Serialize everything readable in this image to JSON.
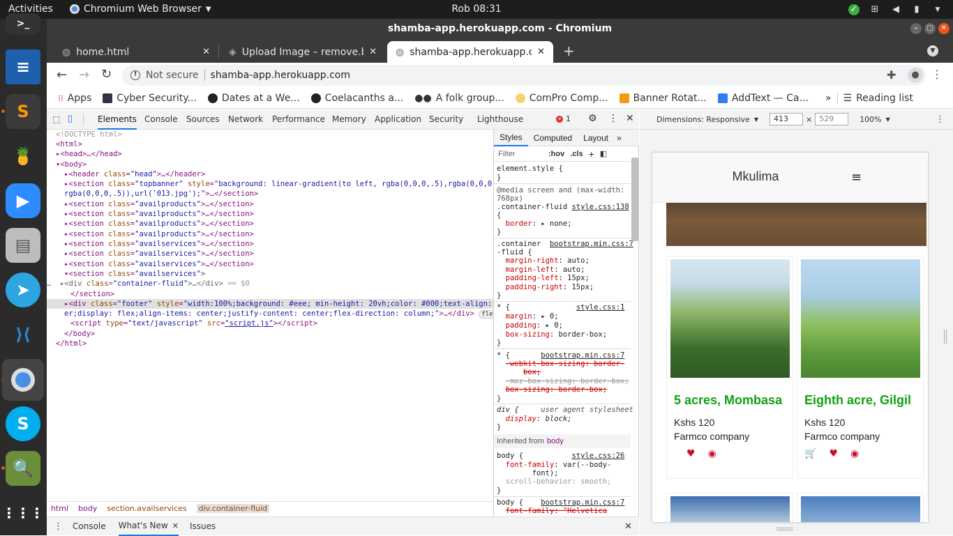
{
  "system": {
    "activities": "Activities",
    "app_name": "Chromium Web Browser",
    "clock": "Rob 08:31"
  },
  "window": {
    "title": "shamba-app.herokuapp.com - Chromium"
  },
  "tabs": [
    {
      "label": "home.html",
      "active": false
    },
    {
      "label": "Upload Image – remove.bg",
      "active": false
    },
    {
      "label": "shamba-app.herokuapp.com",
      "active": true
    }
  ],
  "omnibar": {
    "security": "Not secure",
    "url": "shamba-app.herokuapp.com"
  },
  "bookmarks": {
    "items": [
      "Apps",
      "Cyber Security...",
      "Dates at a We...",
      "Coelacanths a...",
      "A folk group...",
      "ComPro Comp...",
      "Banner Rotat...",
      "AddText — Ca..."
    ],
    "more": "»",
    "reading_list": "Reading list"
  },
  "devtools": {
    "tabs": [
      "Elements",
      "Console",
      "Sources",
      "Network",
      "Performance",
      "Memory",
      "Application",
      "Security",
      "Lighthouse"
    ],
    "error_count": "1",
    "crumbs": [
      "html",
      "body",
      "section.availservices",
      "div.container-fluid"
    ],
    "drawer_tabs": [
      "Console",
      "What's New",
      "Issues"
    ],
    "styles_tabs": [
      "Styles",
      "Computed",
      "Layout"
    ],
    "filter_placeholder": "Filter",
    "hov": ":hov",
    "cls": ".cls",
    "inherited_label": "Inherited from",
    "inherited_from": "body"
  },
  "device": {
    "label": "Dimensions: Responsive",
    "width": "413",
    "height": "529",
    "zoom": "100%"
  },
  "site": {
    "brand": "Mkulima",
    "cards": [
      {
        "title": "5 acres, Mombasa",
        "price": "Kshs 120",
        "company": "Farmco company"
      },
      {
        "title": "Eighth acre, Gilgil",
        "price": "Kshs 120",
        "company": "Farmco company"
      }
    ]
  }
}
